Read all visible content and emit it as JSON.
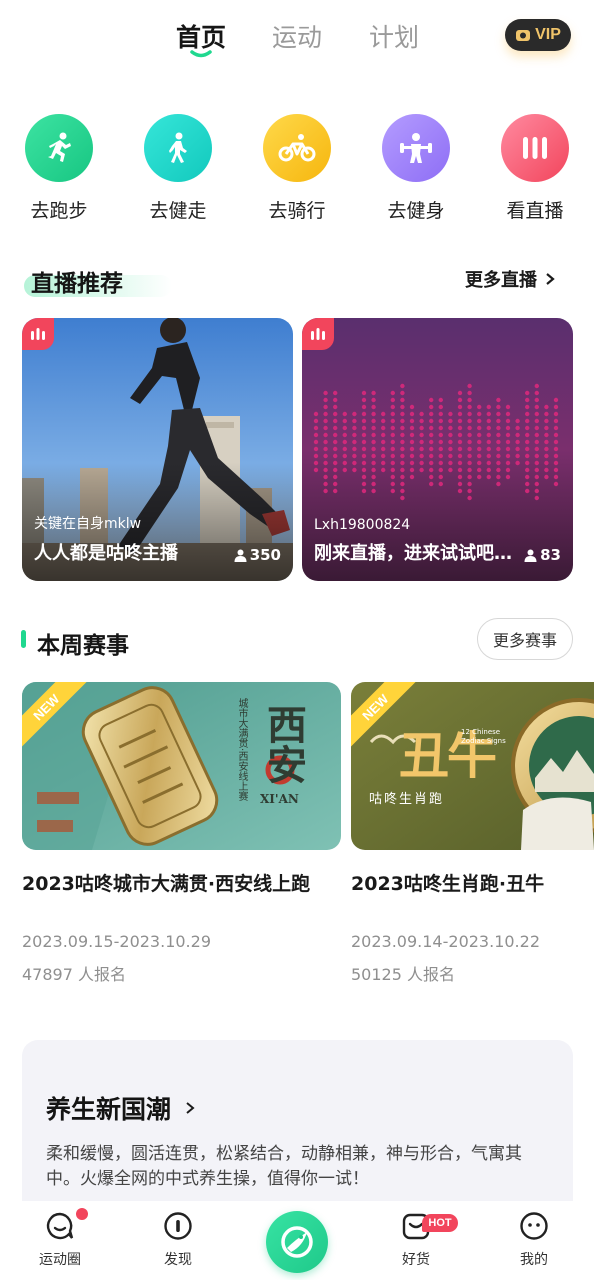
{
  "top_tabs": [
    {
      "label": "首页",
      "active": true
    },
    {
      "label": "运动",
      "active": false
    },
    {
      "label": "计划",
      "active": false
    }
  ],
  "vip": {
    "label": "VIP"
  },
  "quick_actions": [
    {
      "label": "去跑步",
      "icon": "running-icon",
      "color_from": "#3de3a2",
      "color_to": "#17c682"
    },
    {
      "label": "去健走",
      "icon": "walking-icon",
      "color_from": "#36e6d9",
      "color_to": "#12c9bd"
    },
    {
      "label": "去骑行",
      "icon": "cycling-icon",
      "color_from": "#ffd94a",
      "color_to": "#f6b60e"
    },
    {
      "label": "去健身",
      "icon": "fitness-icon",
      "color_from": "#b49cff",
      "color_to": "#8e6ef5"
    },
    {
      "label": "看直播",
      "icon": "live-icon",
      "color_from": "#ff8aa0",
      "color_to": "#f2455c"
    }
  ],
  "live": {
    "title": "直播推荐",
    "more": "更多直播",
    "cards": [
      {
        "host": "关键在自身mklw",
        "title": "人人都是咕咚主播",
        "viewers": "350"
      },
      {
        "host": "Lxh19800824",
        "title": "刚来直播，进来试试吧...",
        "viewers": "83"
      }
    ]
  },
  "events": {
    "title": "本周赛事",
    "more": "更多赛事",
    "badge": "NEW",
    "cards": [
      {
        "name": "2023咕咚城市大满贯·西安线上跑",
        "dates": "2023.09.15-2023.10.29",
        "count": "47897 人报名",
        "art_title": "西安",
        "art_sub": "XI'AN",
        "art_vertical": "城市大满贯·西安线上赛"
      },
      {
        "name": "2023咕咚生肖跑·丑牛",
        "dates": "2023.09.14-2023.10.22",
        "count": "50125 人报名",
        "art_title": "丑牛",
        "art_sub": "咕咚生肖跑",
        "art_tag": "12 Chinese Zodiac Signs"
      }
    ]
  },
  "health": {
    "title": "养生新国潮",
    "desc": "柔和缓慢，圆活连贯，松紧结合，动静相兼，神与形合，气寓其中。火爆全网的中式养生操，值得你一试！"
  },
  "bottom_nav": [
    {
      "label": "运动圈",
      "icon": "chat-bubble-icon",
      "dot": true
    },
    {
      "label": "发现",
      "icon": "compass-icon"
    },
    {
      "label": "",
      "icon": "bird-logo-icon"
    },
    {
      "label": "好货",
      "icon": "shop-bag-icon",
      "badge": "HOT"
    },
    {
      "label": "我的",
      "icon": "profile-icon"
    }
  ],
  "colors": {
    "accent": "#1fd88f",
    "live_red": "#f2455c"
  }
}
